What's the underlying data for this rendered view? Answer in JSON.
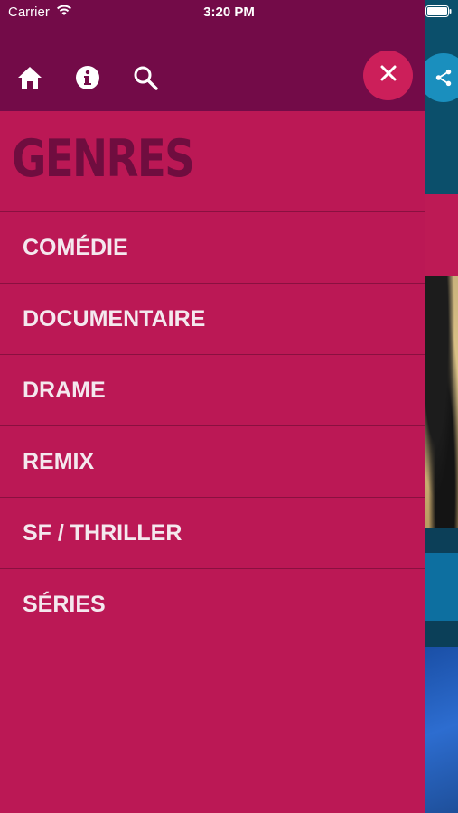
{
  "status_bar": {
    "carrier": "Carrier",
    "time": "3:20 PM"
  },
  "header": {
    "icons": [
      "home-icon",
      "info-icon",
      "search-icon"
    ],
    "close_icon": "close-icon"
  },
  "drawer": {
    "title": "GENRES",
    "items": [
      {
        "label": "COMÉDIE"
      },
      {
        "label": "DOCUMENTAIRE"
      },
      {
        "label": "DRAME"
      },
      {
        "label": "REMIX"
      },
      {
        "label": "SF / THRILLER"
      },
      {
        "label": "SÉRIES"
      }
    ]
  },
  "colors": {
    "drawer_bg": "#bb1855",
    "header_bg": "#730b48",
    "title_color": "#6f0d3f",
    "close_button_bg": "#cc1f5a",
    "item_text": "#f4e8ee"
  }
}
